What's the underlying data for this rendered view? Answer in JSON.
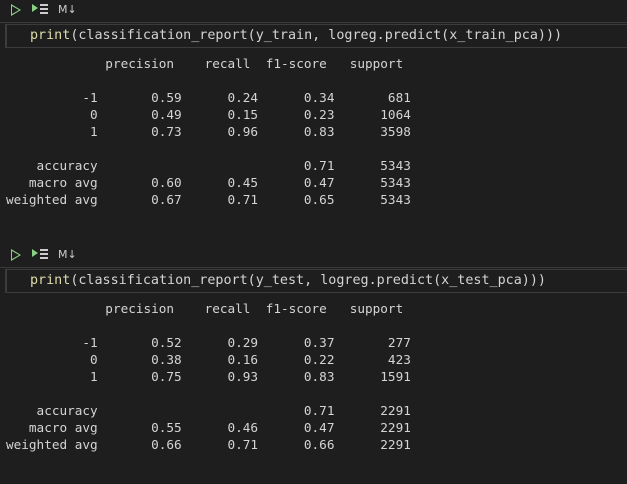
{
  "cells": [
    {
      "toolbar": {
        "run_icon": "run-icon",
        "run_below_icon": "run-below-icon",
        "md_label": "M↓"
      },
      "code": {
        "prefix": "print",
        "rest": "(classification_report(y_train, logreg.predict(x_train_pca)))"
      },
      "report": {
        "header": "             precision    recall  f1-score   support",
        "rows": [
          "",
          "          -1       0.59      0.24      0.34       681",
          "           0       0.49      0.15      0.23      1064",
          "           1       0.73      0.96      0.83      3598",
          "",
          "    accuracy                           0.71      5343",
          "   macro avg       0.60      0.45      0.47      5343",
          "weighted avg       0.67      0.71      0.65      5343"
        ]
      }
    },
    {
      "toolbar": {
        "run_icon": "run-icon",
        "run_below_icon": "run-below-icon",
        "md_label": "M↓"
      },
      "code": {
        "prefix": "print",
        "rest": "(classification_report(y_test, logreg.predict(x_test_pca)))"
      },
      "report": {
        "header": "             precision    recall  f1-score   support",
        "rows": [
          "",
          "          -1       0.52      0.29      0.37       277",
          "           0       0.38      0.16      0.22       423",
          "           1       0.75      0.93      0.83      1591",
          "",
          "    accuracy                           0.71      2291",
          "   macro avg       0.55      0.46      0.47      2291",
          "weighted avg       0.66      0.71      0.66      2291"
        ]
      }
    }
  ]
}
